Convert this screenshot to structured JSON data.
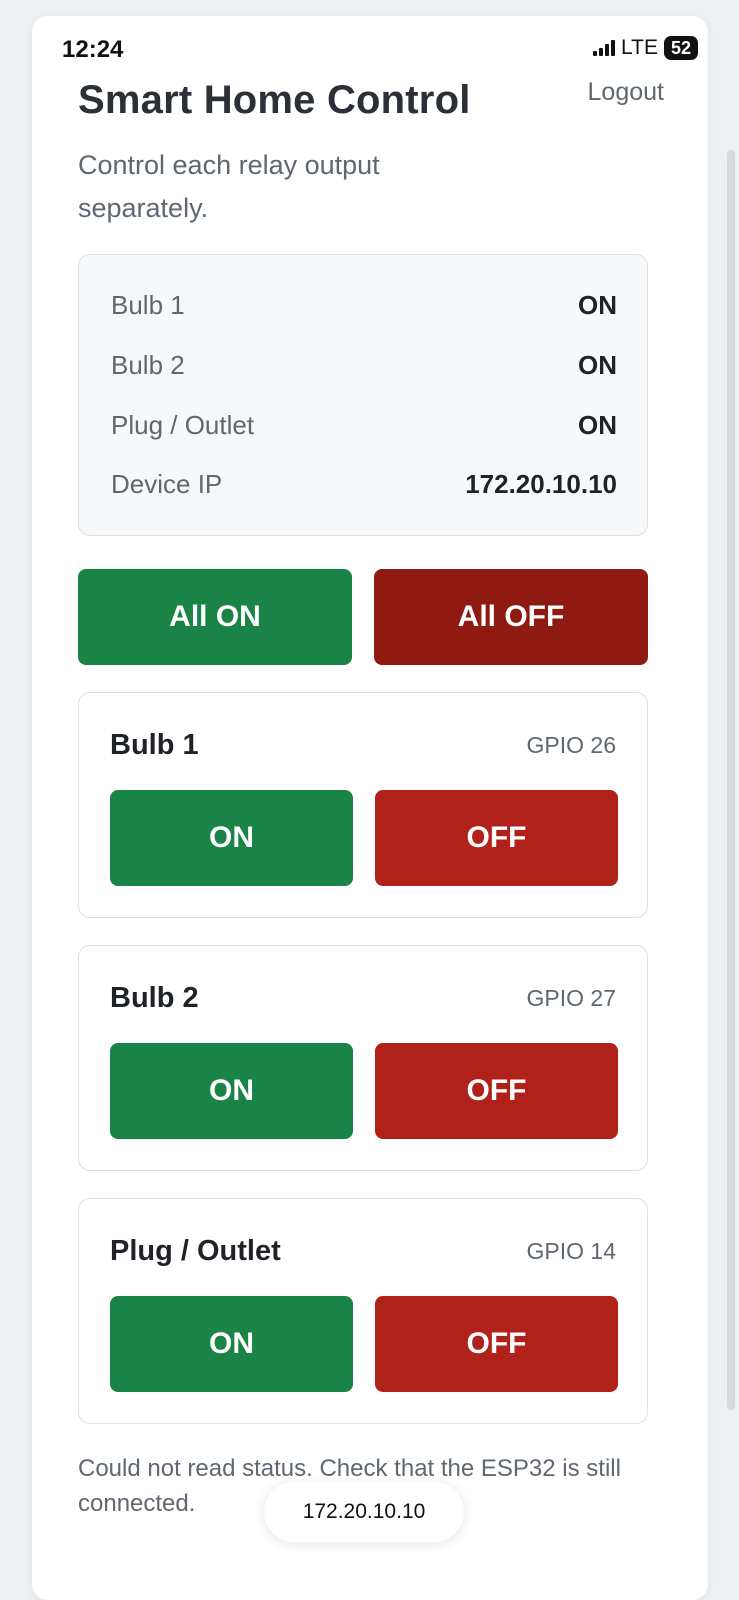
{
  "status_bar": {
    "time": "12:24",
    "network": "LTE",
    "battery": "52"
  },
  "header": {
    "title": "Smart Home Control",
    "logout_label": "Logout",
    "subtitle": "Control each relay output separately."
  },
  "status_panel": {
    "rows": [
      {
        "label": "Bulb 1",
        "value": "ON"
      },
      {
        "label": "Bulb 2",
        "value": "ON"
      },
      {
        "label": "Plug / Outlet",
        "value": "ON"
      },
      {
        "label": "Device IP",
        "value": "172.20.10.10"
      }
    ]
  },
  "master": {
    "all_on_label": "All ON",
    "all_off_label": "All OFF"
  },
  "devices": [
    {
      "name": "Bulb 1",
      "gpio": "GPIO 26",
      "on_label": "ON",
      "off_label": "OFF"
    },
    {
      "name": "Bulb 2",
      "gpio": "GPIO 27",
      "on_label": "ON",
      "off_label": "OFF"
    },
    {
      "name": "Plug / Outlet",
      "gpio": "GPIO 14",
      "on_label": "ON",
      "off_label": "OFF"
    }
  ],
  "footer": {
    "message": "Could not read status. Check that the ESP32 is still connected.",
    "address_pill": "172.20.10.10"
  },
  "colors": {
    "on_green": "#1a8447",
    "all_off_dark_red": "#8e1a12",
    "off_red": "#b0211a"
  },
  "icons": [
    "cellular-signal-icon",
    "battery-icon"
  ]
}
